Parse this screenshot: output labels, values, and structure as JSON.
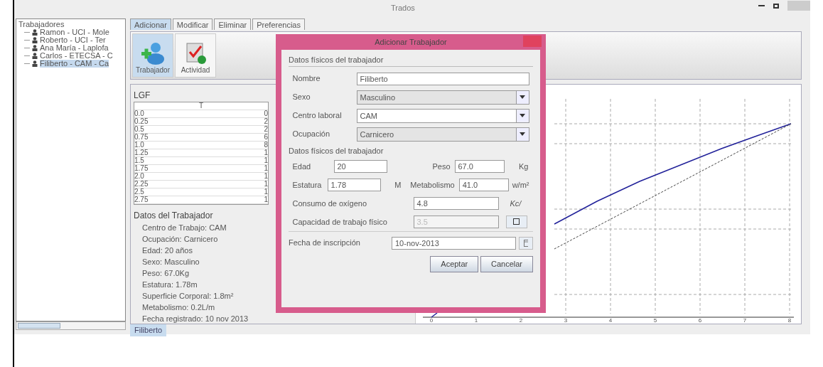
{
  "window": {
    "title": "Trados"
  },
  "tree": {
    "items": [
      {
        "label": "Trabajadores",
        "selected": false,
        "children": [
          {
            "label": "Ramon - UCI - Mole",
            "selected": false
          },
          {
            "label": "Roberto - UCI - Ter",
            "selected": false
          },
          {
            "label": "Ana María - Laplofa",
            "selected": false
          },
          {
            "label": "Carlos - ETECSA - C",
            "selected": false
          },
          {
            "label": "Filiberto - CAM - Ca",
            "selected": true
          }
        ]
      }
    ]
  },
  "tabs": [
    {
      "label": "Adicionar",
      "selected": true
    },
    {
      "label": "Modificar",
      "selected": false
    },
    {
      "label": "Eliminar",
      "selected": false
    },
    {
      "label": "Preferencias",
      "selected": false
    }
  ],
  "toolbar": [
    {
      "label": "Trabajador",
      "selected": true,
      "kind": "worker"
    },
    {
      "label": "Actividad",
      "selected": false,
      "kind": "activity"
    }
  ],
  "lgf": {
    "title": "LGF",
    "columns": [
      "T"
    ],
    "rows": [
      [
        "0.0",
        "0"
      ],
      [
        "0.25",
        "2"
      ],
      [
        "0.5",
        "2"
      ],
      [
        "0.75",
        "6"
      ],
      [
        "1.0",
        "8"
      ],
      [
        "1.25",
        "1"
      ],
      [
        "1.5",
        "1"
      ],
      [
        "1.75",
        "1"
      ],
      [
        "2.0",
        "1"
      ],
      [
        "2.25",
        "1"
      ],
      [
        "2.5",
        "1"
      ],
      [
        "2.75",
        "1"
      ]
    ]
  },
  "details": {
    "title": "Datos del Trabajador",
    "lines": [
      "Centro de Trabajo: CAM",
      "Ocupación: Carnicero",
      "Edad: 20 años",
      "Sexo: Masculino",
      "Peso: 67.0Kg",
      "Estatura: 1.78m",
      "Superficie Corporal: 1.8m²",
      "Metabolismo: 0.2L/m",
      "Fecha registrado: 10 nov 2013"
    ]
  },
  "bottom_tabs": [
    {
      "label": "Filiberto",
      "selected": true
    }
  ],
  "chart": {
    "x_tick_labels": [
      "0",
      "1",
      "2",
      "3",
      "4",
      "5",
      "6",
      "7",
      "8"
    ]
  },
  "dialog": {
    "title": "Adicionar Trabajador",
    "basic": {
      "title": "Datos físicos del trabajador",
      "fields": [
        {
          "kind": "text",
          "label": "Nombre",
          "value": "Filiberto"
        },
        {
          "kind": "combo",
          "label": "Sexo",
          "value": "Masculino",
          "editable": false
        },
        {
          "kind": "combo",
          "label": "Centro laboral",
          "value": "CAM",
          "editable": true
        },
        {
          "kind": "combo",
          "label": "Ocupación",
          "value": "Carnicero",
          "editable": false
        }
      ]
    },
    "physical": {
      "title": "Datos físicos del trabajador",
      "pairs": [
        [
          {
            "label": "Edad",
            "value": "20"
          },
          {
            "label": "Peso",
            "value": "67.0",
            "unit": "Kg"
          }
        ],
        [
          {
            "label": "Estatura",
            "value": "1.78",
            "unit": "M"
          },
          {
            "label": "Metabolismo",
            "value": "41.0",
            "unit": "w/m²"
          }
        ]
      ],
      "wide": [
        {
          "kind": "unit",
          "label": "Consumo de oxígeno",
          "value": "4.8",
          "unit": "Kc/",
          "disabled": false
        },
        {
          "kind": "button",
          "label": "Capacidad de trabajo físico",
          "value": "3.5",
          "disabled": true
        }
      ]
    },
    "date": {
      "label": "Fecha de inscripción",
      "value": "10-nov-2013"
    },
    "buttons": [
      "Aceptar",
      "Cancelar"
    ]
  }
}
